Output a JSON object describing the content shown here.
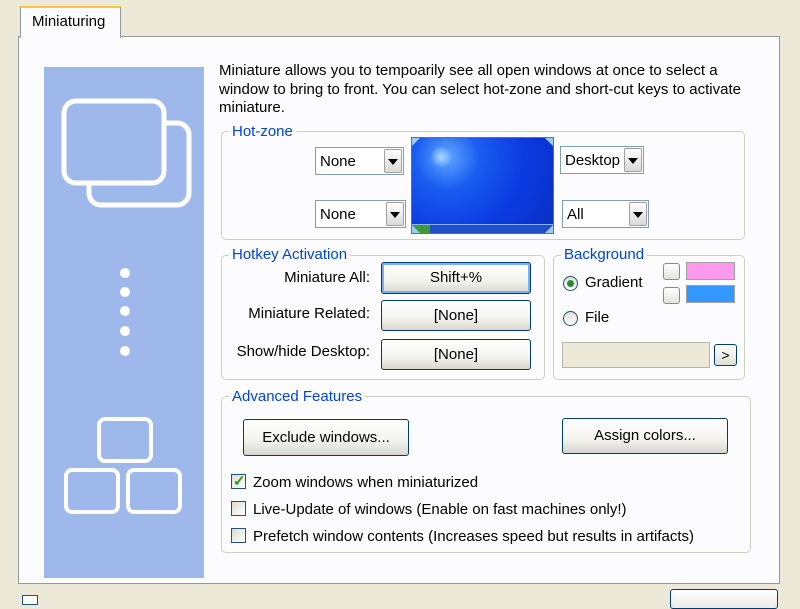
{
  "tab": {
    "label": "Miniaturing"
  },
  "description": "Miniature allows you to tempoarily see all open windows at once to select a window to bring to front. You can select hot-zone and short-cut keys to activate miniature.",
  "hotzone": {
    "title": "Hot-zone",
    "top_left": "None",
    "bottom_left": "None",
    "top_right": "Desktop",
    "bottom_right": "All"
  },
  "hotkey": {
    "title": "Hotkey Activation",
    "rows": [
      {
        "label": "Miniature All:",
        "value": "Shift+%"
      },
      {
        "label": "Miniature Related:",
        "value": "[None]"
      },
      {
        "label": "Show/hide Desktop:",
        "value": "[None]"
      }
    ]
  },
  "background": {
    "title": "Background",
    "gradient_label": "Gradient",
    "file_label": "File",
    "browse_label": ">",
    "selected": "Gradient",
    "color_top": "#ff99ee",
    "color_bottom": "#3399ff"
  },
  "advanced": {
    "title": "Advanced Features",
    "exclude_label": "Exclude windows...",
    "assign_label": "Assign colors...",
    "options": [
      {
        "label": "Zoom windows when miniaturized",
        "checked": true
      },
      {
        "label": "Live-Update of windows (Enable on fast machines only!)",
        "checked": false
      },
      {
        "label": "Prefetch window contents (Increases speed but results in artifacts)",
        "checked": false
      }
    ]
  },
  "colors": {
    "accent_title": "#0046d5",
    "panel": "#9fb8ec"
  }
}
